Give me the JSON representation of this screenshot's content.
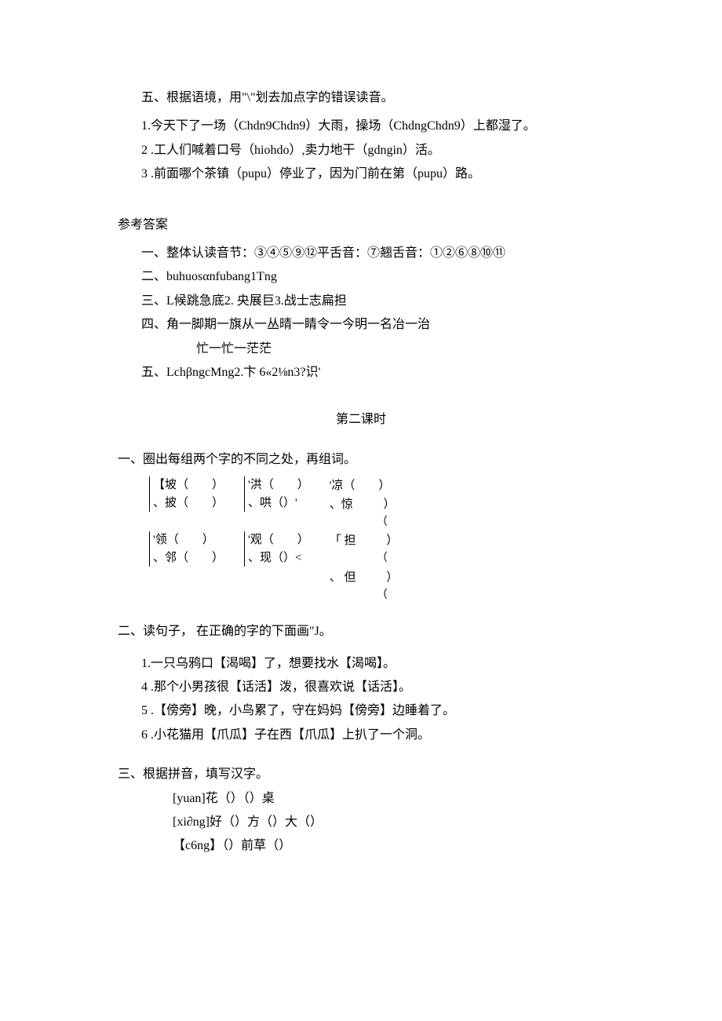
{
  "sec5": {
    "title": "五、根据语境，用\"\\\"划去加点字的错误读音。",
    "q1": "1.今天下了一场（Chdn9Chdn9）大雨，操场（ChdngChdn9）上都湿了。",
    "q2": "2 .工人们喊着口号（hiohdo）,卖力地干（gdngin）活。",
    "q3": "3 .前面哪个茶镇（pupu）停业了，因为门前在第（pupu）路。"
  },
  "answers": {
    "title": "参考答案",
    "a1": "一、整体认读音节：③④⑤⑨⑫平舌音：⑦翘舌音：①②⑥⑧⑩⑪",
    "a2": "二、buhuosαnfubang1Tng",
    "a3": "三、L候跳急底2. 央展巨3.战士志扁担",
    "a4": "四、角一脚期一旗从一丛晴一睛令一今明一名冶一治",
    "a4b": "忙一忙一茫茫",
    "a5": "五、LchβngcMng2.卞 6«2⅛n3?识'"
  },
  "lesson2": "第二课时",
  "b1": {
    "title": "一、圈出每组两个字的不同之处，再组词。"
  },
  "table": {
    "r1c1a": "【坡（　　）",
    "r1c1b": "、披（　　）",
    "r1c2a": "'洪（　　）",
    "r1c2b": "、哄（）'",
    "r1c3a": "'凉（　　）",
    "r1c3b": "、惊",
    "r1c3b_p": "（",
    "r1c3b_r": "）",
    "r2c1a": "'领（　　）",
    "r2c1b": "、邻（　　）",
    "r2c2a": "'观（　　）",
    "r2c2b": "、现（）<",
    "r2c3a": "「 担",
    "r2c3a_p": "（",
    "r2c3a_r": "）",
    "r2c3b": "、 但",
    "r2c3b_p": "（",
    "r2c3b_r": "）"
  },
  "b2": {
    "title": "二、读句子， 在正确的字的下面画\"J。",
    "q1": "1.一只乌鸦口【渴喝】了，想要找水【渴喝】。",
    "q2": "4 .那个小男孩很【话活】泼，很喜欢说【话活】。",
    "q3": "5 .【傍旁】晚，小鸟累了，守在妈妈【傍旁】边睡着了。",
    "q4": "6 .小花猫用【爪瓜】子在西【爪瓜】上扒了一个洞。"
  },
  "b3": {
    "title": "三、根据拼音，填写汉字。",
    "q1": "[yuan]花（）（）桌",
    "q2": "[xi∂ng]好（）方（）大（）",
    "q3": "【c6ng】（）前草（）"
  }
}
